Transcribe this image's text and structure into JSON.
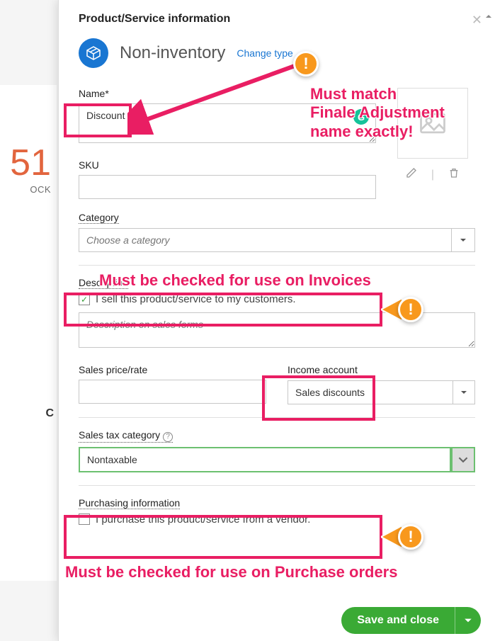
{
  "backdrop": {
    "number_fragment": "51",
    "label_fragment": "OCK",
    "letter_c": "C"
  },
  "panel": {
    "title": "Product/Service information",
    "type": {
      "name": "Non-inventory",
      "change_link": "Change type"
    }
  },
  "fields": {
    "name_label": "Name*",
    "name_value": "Discount",
    "sku_label": "SKU",
    "sku_value": "",
    "category_label": "Category",
    "category_placeholder": "Choose a category",
    "description_label": "Description",
    "sell_checkbox_label": "I sell this product/service to my customers.",
    "sell_checked": true,
    "description_placeholder": "Description on sales forms",
    "sales_price_label": "Sales price/rate",
    "sales_price_value": "",
    "income_account_label": "Income account",
    "income_account_value": "Sales discounts",
    "sales_tax_label": "Sales tax category",
    "sales_tax_value": "Nontaxable",
    "purchasing_label": "Purchasing information",
    "purchase_checkbox_label": "I purchase this product/service from a vendor.",
    "purchase_checked": false
  },
  "footer": {
    "save_label": "Save and close"
  },
  "annotations": {
    "name_note": "Must match\nFinale Adjustment\nname exactly!",
    "invoice_note": "Must be checked for use on Invoices",
    "po_note": "Must be checked for use on Purchase orders",
    "badge": "!"
  }
}
